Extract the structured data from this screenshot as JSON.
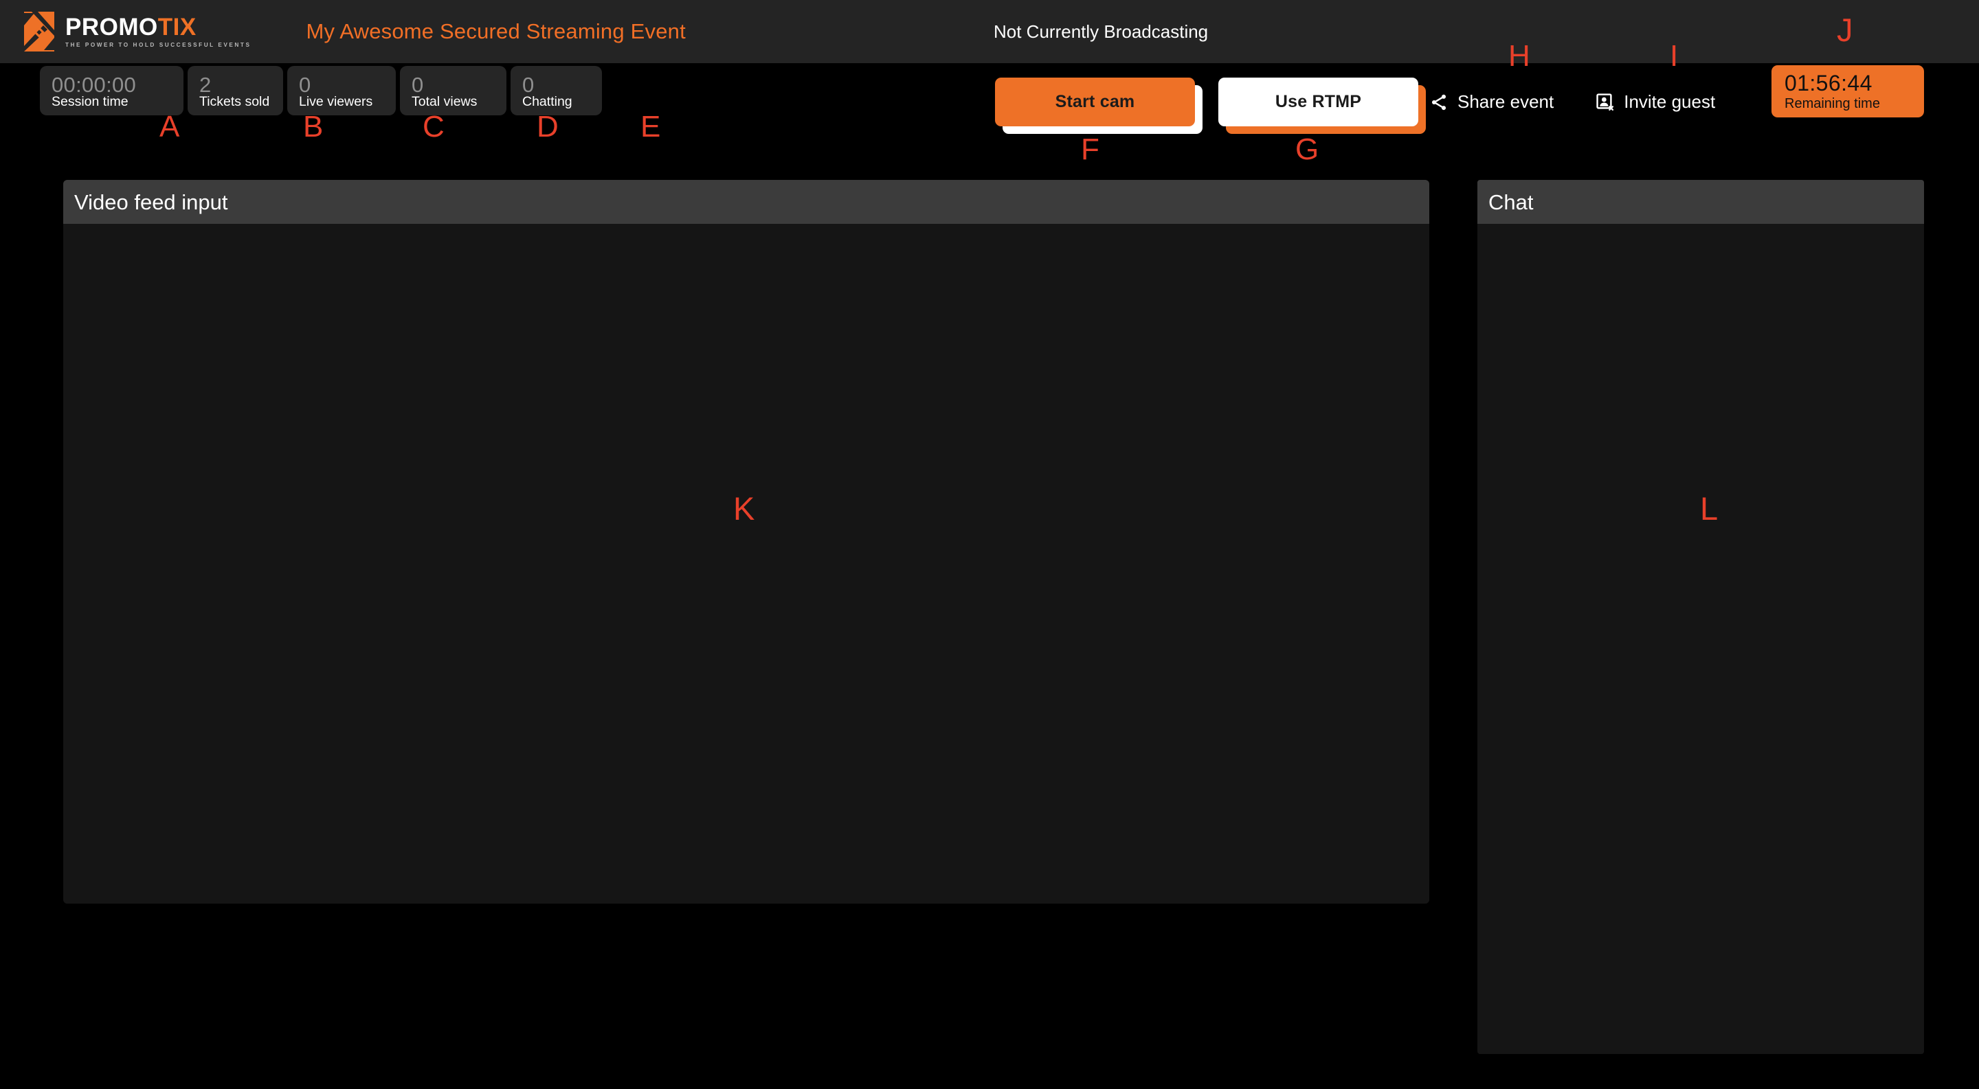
{
  "brand": {
    "name_white": "PROMO",
    "name_accent": "TIX",
    "tagline": "THE POWER TO HOLD SUCCESSFUL EVENTS",
    "logo_icon": "promotix-monogram-icon",
    "accent_color": "#ee7127"
  },
  "header": {
    "event_title": "My Awesome Secured Streaming Event",
    "broadcast_status": "Not Currently Broadcasting"
  },
  "stats": [
    {
      "value": "00:00:00",
      "label": "Session time",
      "name": "session-time"
    },
    {
      "value": "2",
      "label": "Tickets sold",
      "name": "tickets-sold"
    },
    {
      "value": "0",
      "label": "Live viewers",
      "name": "live-viewers"
    },
    {
      "value": "0",
      "label": "Total views",
      "name": "total-views"
    },
    {
      "value": "0",
      "label": "Chatting",
      "name": "chatting"
    }
  ],
  "actions": {
    "start_cam": "Start cam",
    "use_rtmp": "Use RTMP",
    "share_event": "Share event",
    "invite_guest": "Invite guest",
    "share_icon": "share-icon",
    "invite_icon": "invite-guest-icon"
  },
  "remaining": {
    "value": "01:56:44",
    "label": "Remaining time"
  },
  "panels": {
    "video_title": "Video feed input",
    "chat_title": "Chat"
  },
  "markers": {
    "a": "A",
    "b": "B",
    "c": "C",
    "d": "D",
    "e": "E",
    "f": "F",
    "g": "G",
    "h": "H",
    "i": "I",
    "j": "J",
    "k": "K",
    "l": "L",
    "color": "#e8402a"
  }
}
